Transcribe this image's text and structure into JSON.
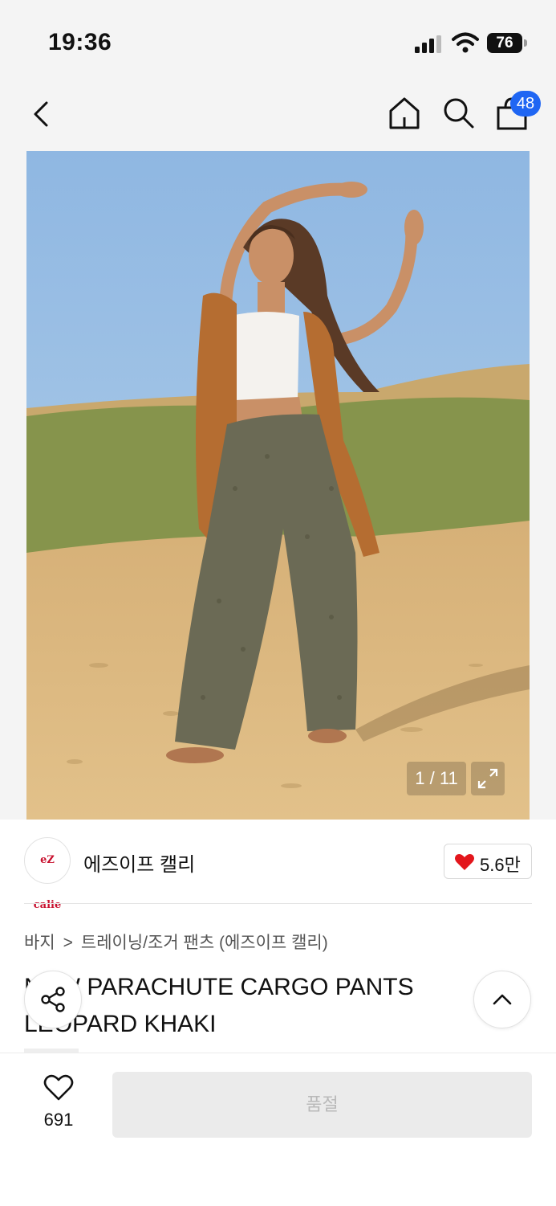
{
  "status_bar": {
    "time": "19:36",
    "battery": "76"
  },
  "nav": {
    "cart_count": "48"
  },
  "gallery": {
    "counter": "1 / 11"
  },
  "brand": {
    "logo_text": "eZ calie",
    "name": "에즈이프 캘리",
    "likes": "5.6만"
  },
  "breadcrumb": {
    "category": "바지",
    "sub": "트레이닝/조거 팬츠 (에즈이프 캘리)",
    "separator": ">"
  },
  "product": {
    "title": "NEW PARACHUTE CARGO PANTS LEOPARD KHAKI"
  },
  "bottom_bar": {
    "wish_count": "691",
    "buy_label": "품절"
  },
  "colors": {
    "accent": "#1f66f3",
    "heart": "#e3161c",
    "sky": "#9ec3e6",
    "sand": "#d8b57e",
    "grass": "#8d9a50"
  }
}
